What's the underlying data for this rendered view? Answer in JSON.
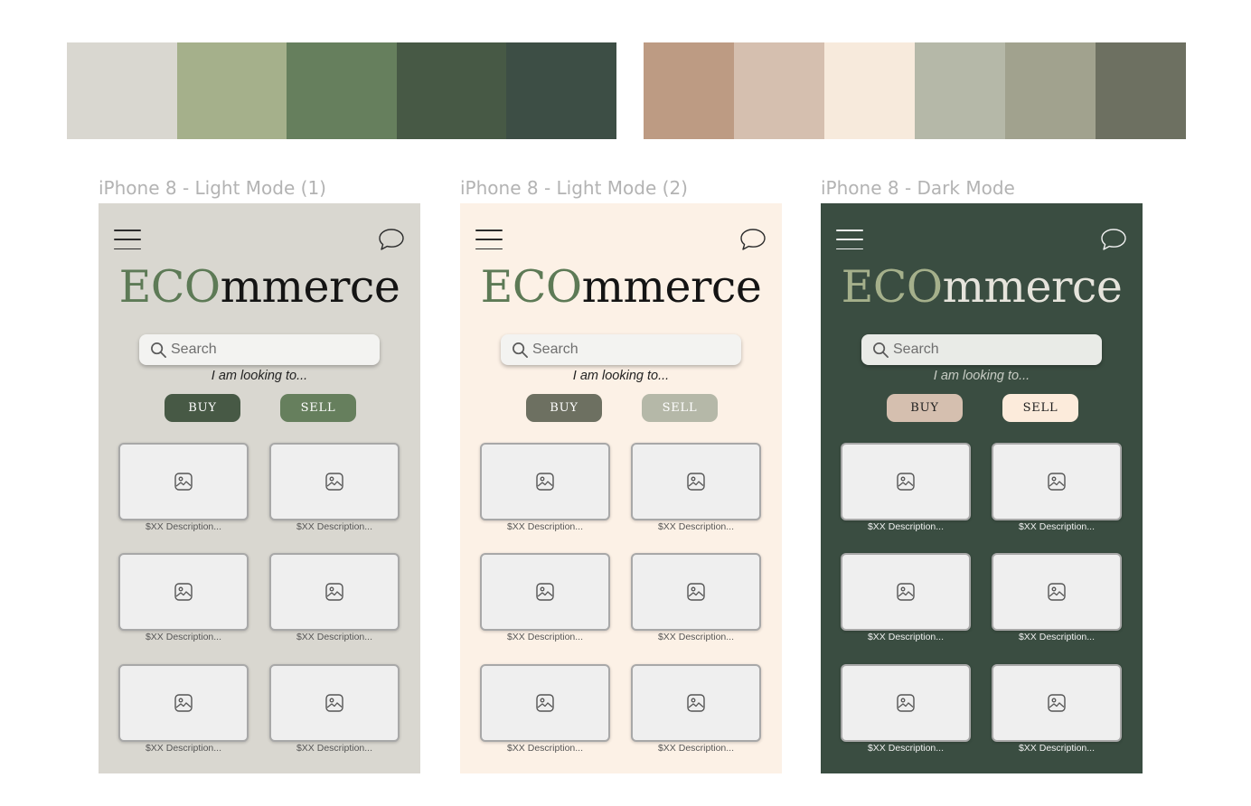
{
  "palettes": [
    {
      "swatches": [
        "#d9d7d0",
        "#a5b08b",
        "#667f5d",
        "#475945",
        "#3d4e45"
      ]
    },
    {
      "swatches": [
        "#bd9b83",
        "#d5bfaf",
        "#f7eadc",
        "#b5b8a8",
        "#a1a28e",
        "#6d7061"
      ]
    }
  ],
  "frames": [
    {
      "label": "iPhone 8 - Light Mode (1)",
      "theme": {
        "background": "#d9d7d0",
        "icon_color": "#2b2b2b",
        "logo_accent": "#5d7a56",
        "logo_rest": "#141414",
        "search_bg": "#f3f3f1",
        "looking_color": "#222222",
        "buy_bg": "#475945",
        "buy_fg": "#ffffff",
        "sell_bg": "#667f5d",
        "sell_fg": "#ffffff",
        "caption_color": "#555555"
      },
      "logo_accent": "ECO",
      "logo_rest": "mmerce",
      "search_placeholder": "Search",
      "looking_text": "I am looking to...",
      "buy_label": "BUY",
      "sell_label": "SELL",
      "listings": [
        "$XX Description...",
        "$XX Description...",
        "$XX Description...",
        "$XX Description...",
        "$XX Description...",
        "$XX Description..."
      ]
    },
    {
      "label": "iPhone 8 - Light Mode (2)",
      "theme": {
        "background": "#fcf1e6",
        "icon_color": "#2b2b2b",
        "logo_accent": "#5d7a56",
        "logo_rest": "#141414",
        "search_bg": "#f3f3f1",
        "looking_color": "#222222",
        "buy_bg": "#6d7061",
        "buy_fg": "#ffffff",
        "sell_bg": "#b5b8a8",
        "sell_fg": "#ffffff",
        "caption_color": "#555555"
      },
      "logo_accent": "ECO",
      "logo_rest": "mmerce",
      "search_placeholder": "Search",
      "looking_text": "I am looking to...",
      "buy_label": "BUY",
      "sell_label": "SELL",
      "listings": [
        "$XX Description...",
        "$XX Description...",
        "$XX Description...",
        "$XX Description...",
        "$XX Description...",
        "$XX Description..."
      ]
    },
    {
      "label": "iPhone 8 - Dark Mode",
      "theme": {
        "background": "#3a4d41",
        "icon_color": "#f2f2f2",
        "logo_accent": "#a5b08b",
        "logo_rest": "#e6e4dc",
        "search_bg": "#e9ebe7",
        "looking_color": "#c8ccc4",
        "buy_bg": "#d5bfaf",
        "buy_fg": "#1e1e1e",
        "sell_bg": "#fcebdb",
        "sell_fg": "#1e1e1e",
        "caption_color": "#f0f0f0"
      },
      "logo_accent": "ECO",
      "logo_rest": "mmerce",
      "search_placeholder": "Search",
      "looking_text": "I am looking to...",
      "buy_label": "BUY",
      "sell_label": "SELL",
      "listings": [
        "$XX Description...",
        "$XX Description...",
        "$XX Description...",
        "$XX Description...",
        "$XX Description...",
        "$XX Description..."
      ]
    }
  ],
  "icons": {
    "menu": "hamburger-menu-icon",
    "chat": "chat-bubble-icon",
    "search": "search-icon",
    "image": "image-placeholder-icon"
  }
}
